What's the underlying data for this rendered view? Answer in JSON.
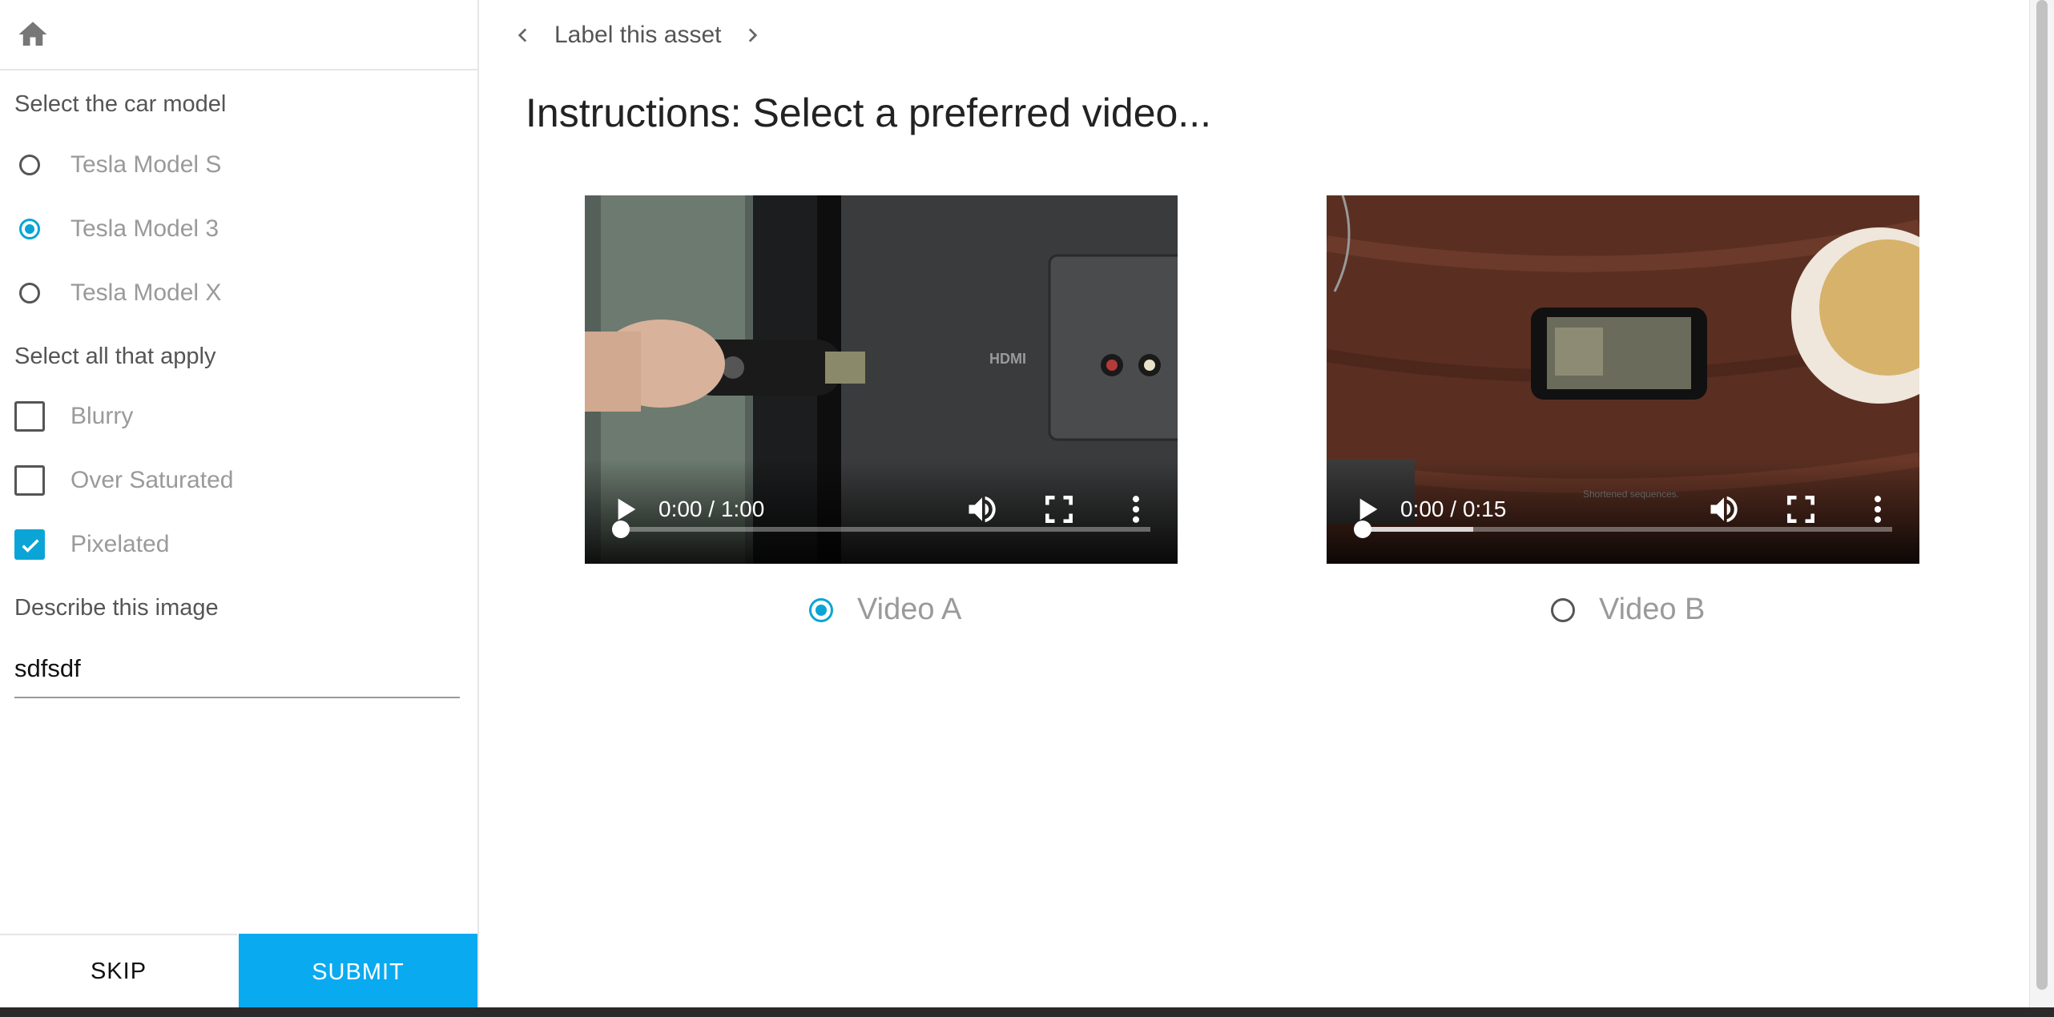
{
  "sidebar": {
    "car_model_label": "Select the car model",
    "car_models": [
      {
        "label": "Tesla Model S",
        "checked": false
      },
      {
        "label": "Tesla Model 3",
        "checked": true
      },
      {
        "label": "Tesla Model X",
        "checked": false
      }
    ],
    "apply_label": "Select all that apply",
    "apply_options": [
      {
        "label": "Blurry",
        "checked": false
      },
      {
        "label": "Over Saturated",
        "checked": false
      },
      {
        "label": "Pixelated",
        "checked": true
      }
    ],
    "describe_label": "Describe this image",
    "describe_value": "sdfsdf",
    "skip_label": "SKIP",
    "submit_label": "SUBMIT"
  },
  "header": {
    "breadcrumb": "Label this asset"
  },
  "main": {
    "instructions": "Instructions: Select a preferred video...",
    "videos": [
      {
        "time": "0:00 / 1:00",
        "choice_label": "Video A",
        "selected": true,
        "buffered_fraction": 0.0
      },
      {
        "time": "0:00 / 0:15",
        "choice_label": "Video B",
        "selected": false,
        "buffered_fraction": 0.21
      }
    ]
  },
  "colors": {
    "accent": "#0aa5d6",
    "submit_bg": "#0aaaf0"
  },
  "icons": [
    "home-icon",
    "chevron-left-icon",
    "chevron-right-icon",
    "play-icon",
    "volume-icon",
    "fullscreen-icon",
    "more-vert-icon",
    "checkmark-icon"
  ]
}
